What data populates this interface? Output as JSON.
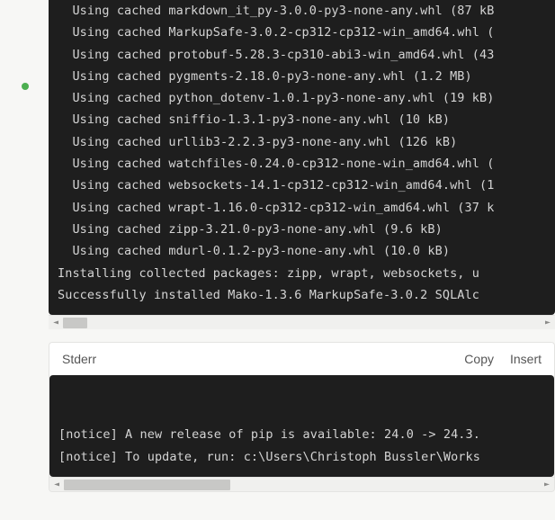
{
  "stdout": {
    "lines": [
      "  Using cached markdown_it_py-3.0.0-py3-none-any.whl (87 kB",
      "  Using cached MarkupSafe-3.0.2-cp312-cp312-win_amd64.whl (",
      "  Using cached protobuf-5.28.3-cp310-abi3-win_amd64.whl (43",
      "  Using cached pygments-2.18.0-py3-none-any.whl (1.2 MB)",
      "  Using cached python_dotenv-1.0.1-py3-none-any.whl (19 kB)",
      "  Using cached sniffio-1.3.1-py3-none-any.whl (10 kB)",
      "  Using cached urllib3-2.2.3-py3-none-any.whl (126 kB)",
      "  Using cached watchfiles-0.24.0-cp312-none-win_amd64.whl (",
      "  Using cached websockets-14.1-cp312-cp312-win_amd64.whl (1",
      "  Using cached wrapt-1.16.0-cp312-cp312-win_amd64.whl (37 k",
      "  Using cached zipp-3.21.0-py3-none-any.whl (9.6 kB)",
      "  Using cached mdurl-0.1.2-py3-none-any.whl (10.0 kB)",
      "Installing collected packages: zipp, wrapt, websockets, u",
      "Successfully installed Mako-1.3.6 MarkupSafe-3.0.2 SQLAlc"
    ],
    "scroll": {
      "thumb_left_pct": 0,
      "thumb_width_pct": 5
    }
  },
  "stderr": {
    "title": "Stderr",
    "actions": {
      "copy": "Copy",
      "insert": "Insert"
    },
    "lines": [
      "",
      "[notice] A new release of pip is available: 24.0 -> 24.3.",
      "[notice] To update, run: c:\\Users\\Christoph Bussler\\Works"
    ],
    "scroll": {
      "thumb_left_pct": 0,
      "thumb_width_pct": 35
    }
  },
  "status": {
    "color": "#4caf50"
  }
}
